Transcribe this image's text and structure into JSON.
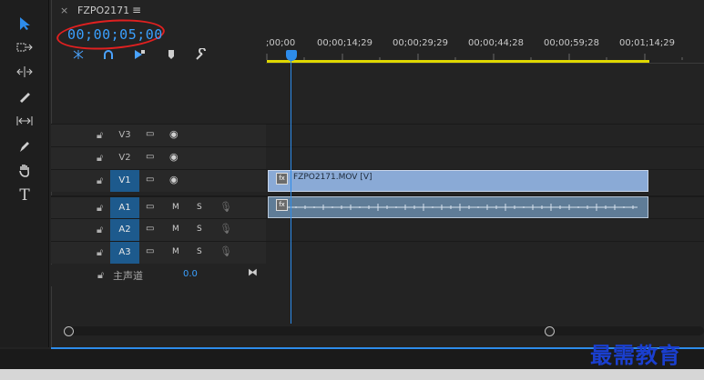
{
  "panel": {
    "close": "×",
    "sequence_name": "FZPO2171",
    "menu": "≡",
    "timecode": "00;00;05;00"
  },
  "header_icons": [
    "snap-icon",
    "linked-selection-icon",
    "add-marker-icon",
    "marker-icon",
    "settings-wrench-icon"
  ],
  "toolbar": [
    "selection-tool-icon",
    "track-select-tool-icon",
    "ripple-edit-tool-icon",
    "razor-tool-icon",
    "slip-tool-icon",
    "pen-tool-icon",
    "hand-tool-icon",
    "type-tool-icon"
  ],
  "ruler": {
    "labels": [
      ";00;00",
      "00;00;14;29",
      "00;00;29;29",
      "00;00;44;28",
      "00;00;59;28",
      "00;01;14;29"
    ]
  },
  "tracks": [
    {
      "name": "V3",
      "kind": "video",
      "targeted": false
    },
    {
      "name": "V2",
      "kind": "video",
      "targeted": false
    },
    {
      "name": "V1",
      "kind": "video",
      "targeted": true
    },
    {
      "name": "A1",
      "kind": "audio",
      "targeted": true,
      "m": "M",
      "s": "S"
    },
    {
      "name": "A2",
      "kind": "audio",
      "targeted": true,
      "m": "M",
      "s": "S"
    },
    {
      "name": "A3",
      "kind": "audio",
      "targeted": true,
      "m": "M",
      "s": "S"
    }
  ],
  "clips": {
    "video_label": "FZPO2171.MOV [V]",
    "badge": "fx"
  },
  "master": {
    "label": "主声道",
    "value": "0.0"
  },
  "watermark": "最需教育",
  "colors": {
    "accent": "#2d8ceb",
    "timecode": "#3aa0ff",
    "target": "#1d5a8d",
    "video_clip": "#8aaad6",
    "audio_clip": "#5f7c97",
    "workarea": "#e0d800",
    "annotation": "#e02020"
  }
}
